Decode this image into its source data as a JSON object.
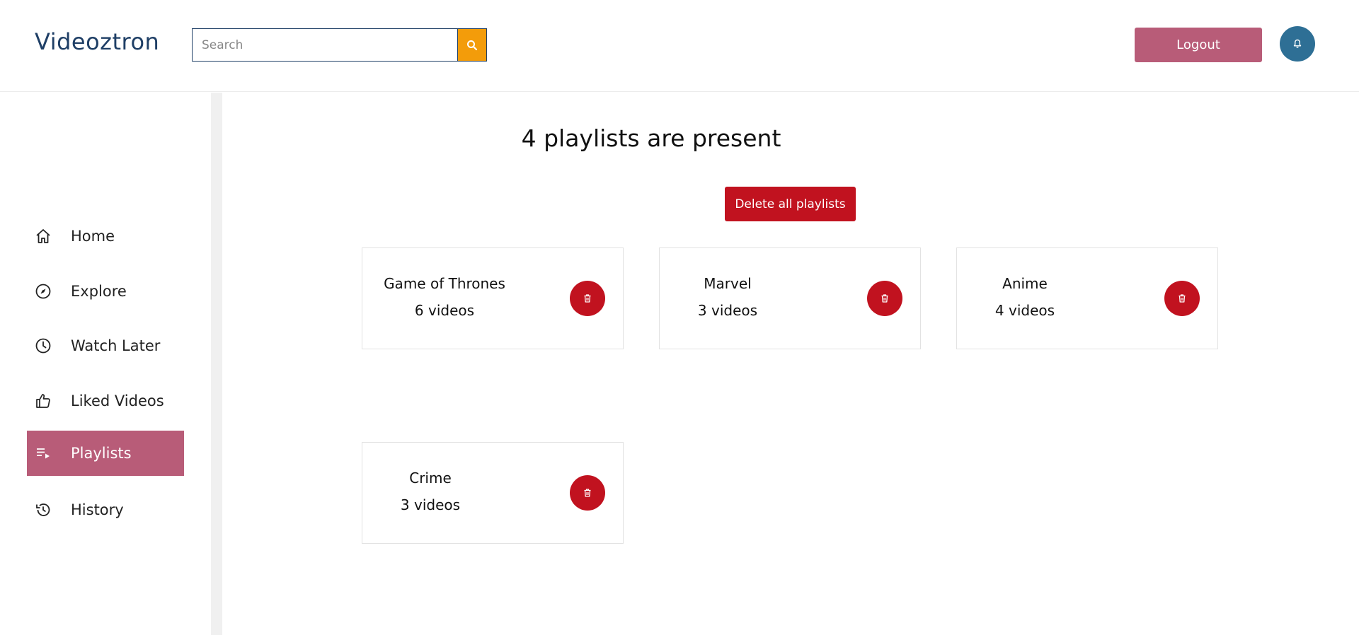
{
  "header": {
    "brand": "Videoztron",
    "search": {
      "placeholder": "Search",
      "value": ""
    },
    "logout_label": "Logout",
    "icons": {
      "search": "search-icon",
      "notifications": "bell-icon"
    },
    "colors": {
      "brand": "#1f3f66",
      "search_button": "#f39c0a",
      "logout": "#b85c78",
      "bell": "#2e6f95"
    }
  },
  "sidebar": {
    "items": [
      {
        "label": "Home",
        "icon": "home-icon",
        "active": false
      },
      {
        "label": "Explore",
        "icon": "compass-icon",
        "active": false
      },
      {
        "label": "Watch Later",
        "icon": "clock-icon",
        "active": false
      },
      {
        "label": "Liked Videos",
        "icon": "thumbs-up-icon",
        "active": false
      },
      {
        "label": "Playlists",
        "icon": "playlist-icon",
        "active": true
      },
      {
        "label": "History",
        "icon": "history-icon",
        "active": false
      }
    ],
    "active_color": "#b85c78"
  },
  "main": {
    "title": "4 playlists are present",
    "delete_all_label": "Delete all playlists",
    "delete_color": "#c1121f",
    "playlists": [
      {
        "name": "Game of Thrones",
        "count": "6 videos"
      },
      {
        "name": "Marvel",
        "count": "3 videos"
      },
      {
        "name": "Anime",
        "count": "4 videos"
      },
      {
        "name": "Crime",
        "count": "3 videos"
      }
    ]
  }
}
